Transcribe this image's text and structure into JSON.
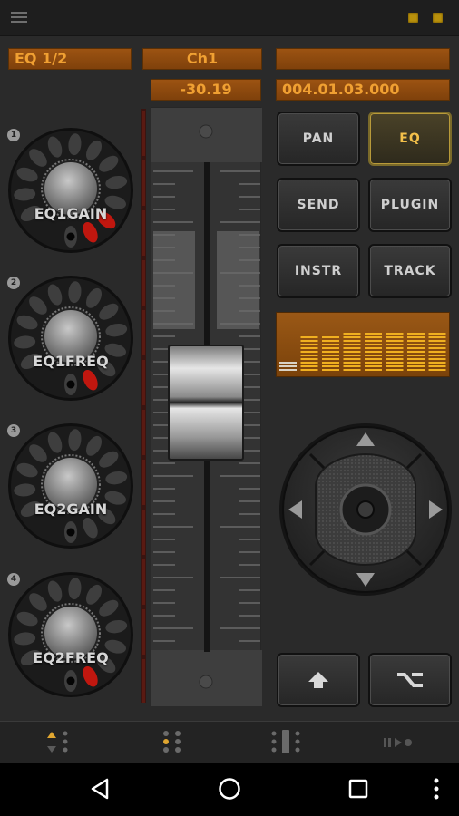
{
  "displays": {
    "eq_page": "EQ 1/2",
    "channel": "Ch1",
    "track_name": "",
    "volume_db": "-30.19",
    "position": "004.01.03.000"
  },
  "knobs": [
    {
      "number": "1",
      "label": "EQ1GAIN",
      "level": 0.15
    },
    {
      "number": "2",
      "label": "EQ1FREQ",
      "level": 0.08
    },
    {
      "number": "3",
      "label": "EQ2GAIN",
      "level": 0.0
    },
    {
      "number": "4",
      "label": "EQ2FREQ",
      "level": 0.05
    }
  ],
  "mode_buttons": {
    "pan": "PAN",
    "eq": "EQ",
    "send": "SEND",
    "plugin": "PLUGIN",
    "instr": "INSTR",
    "track": "TRACK",
    "active": "EQ"
  },
  "fader": {
    "level": 0.6
  },
  "spectrum": {
    "bars": [
      0.22,
      0.62,
      0.62,
      0.7,
      0.7,
      0.7,
      0.7,
      0.7
    ]
  },
  "icons": {
    "menu": "menu-icon",
    "shift": "shift-arrow-icon",
    "option": "option-key-icon",
    "nav_back": "triangle-back-icon",
    "nav_home": "circle-home-icon",
    "nav_recents": "square-recents-icon"
  },
  "colors": {
    "display_text": "#f0a032",
    "display_bg": "#8a480e",
    "active_button": "#f3c04a",
    "knob_red": "#c0170f",
    "led": "#b8900c"
  }
}
